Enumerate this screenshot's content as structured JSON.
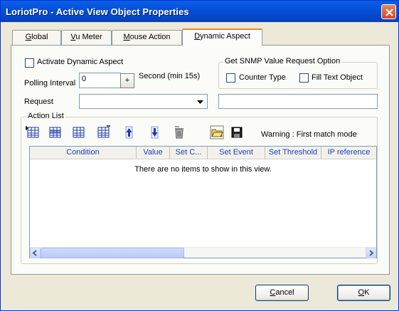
{
  "window": {
    "title": "LoriotPro - Active View Object Properties"
  },
  "tabs": [
    {
      "label": "Global",
      "mnemonic": "G",
      "rest": "lobal"
    },
    {
      "label": "Vu Meter",
      "mnemonic": "V",
      "rest": "u Meter"
    },
    {
      "label": "Mouse Action",
      "mnemonic": "M",
      "rest": "ouse Action"
    },
    {
      "label": "Dynamic Aspect",
      "mnemonic": "D",
      "rest": "ynamic Aspect"
    }
  ],
  "active_tab": "Dynamic Aspect",
  "dynamic": {
    "activate_label": "Activate Dynamic Aspect",
    "activate_checked": false,
    "polling_label": "Polling Interval",
    "polling_value": "0",
    "polling_plus": "+",
    "seconds_label": "Second (min 15s)",
    "request_label": "Request",
    "request_value": "",
    "request_text": ""
  },
  "snmp_group": {
    "label": "Get SNMP Value Request Option",
    "counter_label": "Counter Type",
    "counter_checked": false,
    "fill_label": "Fill Text Object",
    "fill_checked": false
  },
  "action_list": {
    "label": "Action List",
    "warning": "Warning : First match mode",
    "toolbar_icons": [
      "add-row-icon",
      "insert-row-icon",
      "edit-row-icon",
      "delete-row-icon",
      "move-up-icon",
      "move-down-icon",
      "trash-icon",
      "open-folder-icon",
      "save-icon"
    ],
    "columns": [
      "Condition",
      "Value",
      "Set C...",
      "Set Event",
      "Set Threshold",
      "IP reference"
    ],
    "empty_message": "There are no items to show in this view."
  },
  "buttons": {
    "cancel": {
      "label": "Cancel",
      "mnemonic": "C",
      "rest": "ancel"
    },
    "ok": {
      "label": "OK",
      "mnemonic": "O",
      "rest": "K"
    }
  },
  "colors": {
    "titlebar": "#0551d8",
    "header_text": "#1d3cc9",
    "tab_highlight": "#e68b2c",
    "toolbar_icon_blue": "#1c3aa8"
  }
}
